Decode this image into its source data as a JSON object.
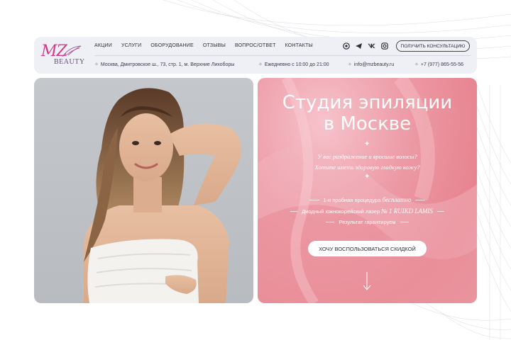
{
  "brand": {
    "logo_mz": "MZ",
    "logo_beauty": "BEAUTY",
    "accent_pink": "#d23a8a"
  },
  "nav": {
    "items": [
      "АКЦИИ",
      "УСЛУГИ",
      "ОБОРУДОВАНИЕ",
      "ОТЗЫВЫ",
      "ВОПРОС/ОТВЕТ",
      "КОНТАКТЫ"
    ]
  },
  "social": [
    "whatsapp-icon",
    "telegram-icon",
    "vk-icon",
    "instagram-icon"
  ],
  "header": {
    "cta_label": "ПОЛУЧИТЬ КОНСУЛЬТАЦИЮ",
    "address": "Москва, Дмитровское ш., 73, стр. 1, м. Верхние Лихоборы",
    "hours": "Ежедневно с 10:00 до 21:00",
    "email": "info@mzbeauty.ru",
    "phone": "+7 (977) 865-55-56"
  },
  "hero": {
    "title_line1": "Студия эпиляции",
    "title_line2": "в Москве",
    "question_line1": "У вас раздражение и вросшие волосы?",
    "question_line2": "Хотите иметь здоровую гладкую кожу?",
    "feature1_prefix": "1-я пробная процедура ",
    "feature1_em": "бесплатно",
    "feature2_prefix": "Диодный южнокорейский лазер ",
    "feature2_em": "№ 1 RUIKD LAMIS",
    "feature3": "Результат гарантируем",
    "button_label": "ХОЧУ ВОСПОЛЬЗОВАТЬСЯ СКИДКОЙ"
  }
}
